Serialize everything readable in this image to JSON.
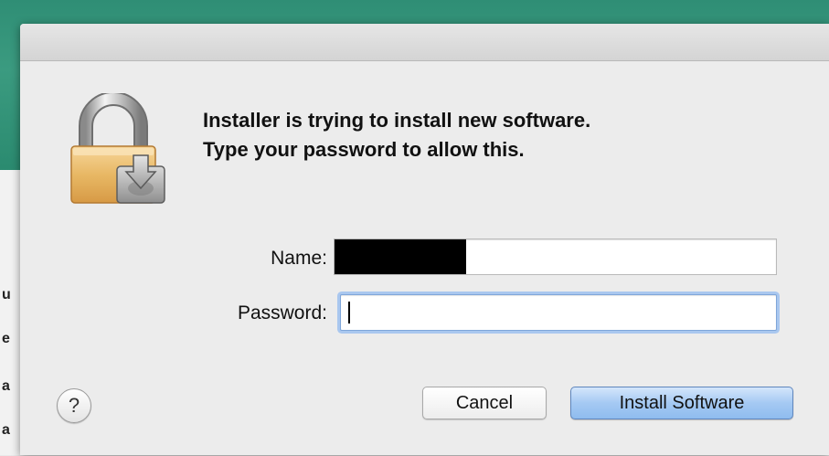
{
  "background": {
    "partial_letters": [
      "u",
      "e",
      "a",
      "a"
    ]
  },
  "dialog": {
    "icon": "lock-with-installer-disk-icon",
    "message_line1": "Installer is trying to install new software.",
    "message_line2": "Type your password to allow this.",
    "name_label": "Name:",
    "name_value_redacted": true,
    "password_label": "Password:",
    "password_value": "",
    "help_label": "?",
    "cancel_label": "Cancel",
    "install_label": "Install Software"
  },
  "colors": {
    "desktop_green": "#2f8e75",
    "default_button_blue": "#a5c9f3",
    "focus_ring": "#a9c7ef"
  }
}
